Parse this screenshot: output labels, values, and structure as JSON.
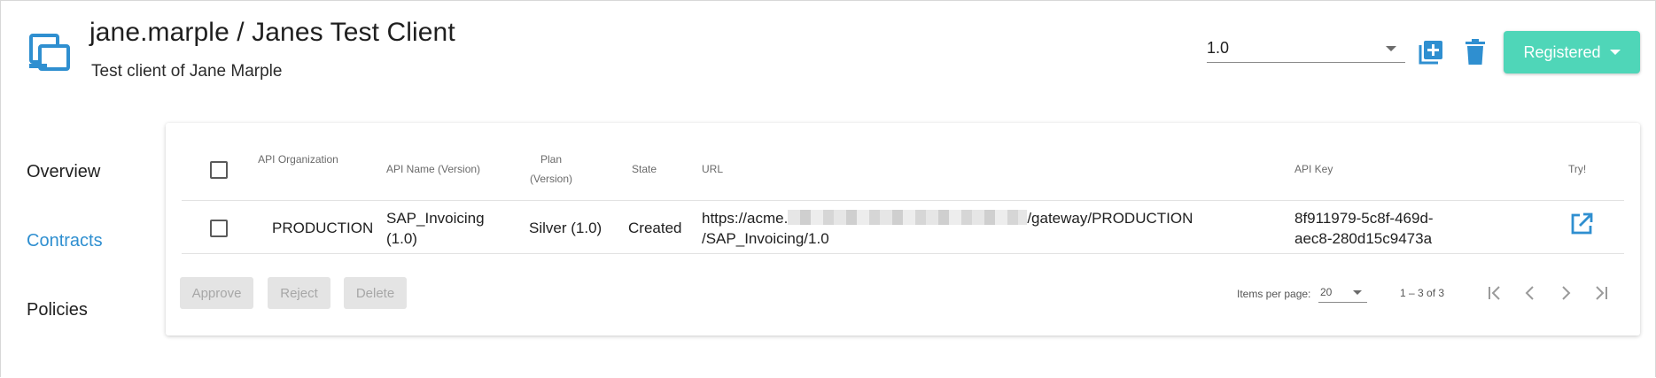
{
  "header": {
    "title": "jane.marple / Janes Test Client",
    "description": "Test client of Jane Marple",
    "version": "1.0",
    "status_label": "Registered",
    "icons": {
      "client": "devices-icon",
      "new_version": "library-add-icon",
      "delete": "trash-icon",
      "status_menu": "caret-down-icon"
    }
  },
  "nav": {
    "items": [
      {
        "label": "Overview",
        "active": false
      },
      {
        "label": "Contracts",
        "active": true
      },
      {
        "label": "Policies",
        "active": false
      }
    ]
  },
  "table": {
    "headers": {
      "api_organization": "API Organization",
      "api_name": "API Name (Version)",
      "plan": "Plan (Version)",
      "state": "State",
      "url": "URL",
      "api_key": "API Key",
      "try": "Try!"
    },
    "rows": [
      {
        "api_organization": "PRODUCTION",
        "api_name": "SAP_Invoicing (1.0)",
        "plan": "Silver (1.0)",
        "state": "Created",
        "url_prefix": "https://acme.",
        "url_suffix": "/gateway/PRODUCTION",
        "url_line2": "/SAP_Invoicing/1.0",
        "api_key_line1": "8f911979-5c8f-469d-",
        "api_key_line2": "aec8-280d15c9473a"
      }
    ]
  },
  "actions": {
    "approve": "Approve",
    "reject": "Reject",
    "delete": "Delete"
  },
  "paginator": {
    "items_per_page_label": "Items per page:",
    "items_per_page": "20",
    "range": "1 – 3 of 3"
  },
  "colors": {
    "accent": "#2f8fd0",
    "status": "#4fd6b8",
    "disabled_bg": "#e4e4e4"
  }
}
